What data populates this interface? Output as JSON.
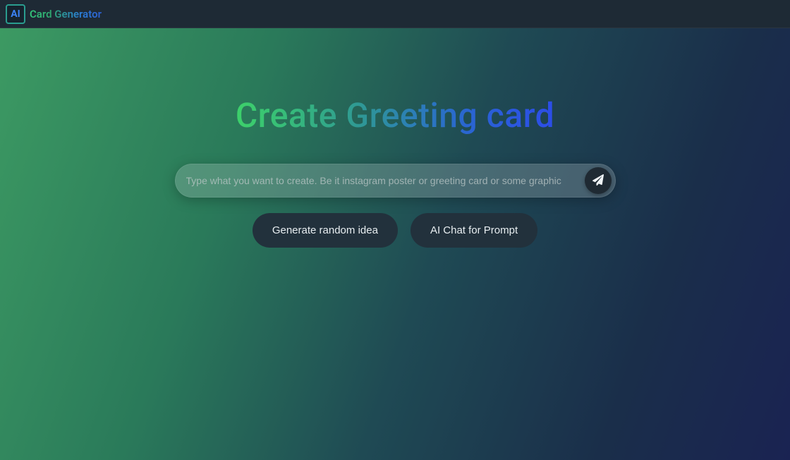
{
  "header": {
    "logo_badge": "AI",
    "brand_text": "Card Generator"
  },
  "hero": {
    "headline_full": "Create  Greeting  card"
  },
  "search": {
    "placeholder": "Type what you want to create. Be it instagram poster or greeting card or some graphic",
    "value": ""
  },
  "actions": {
    "generate_random": "Generate random idea",
    "ai_chat": "AI Chat for Prompt"
  }
}
